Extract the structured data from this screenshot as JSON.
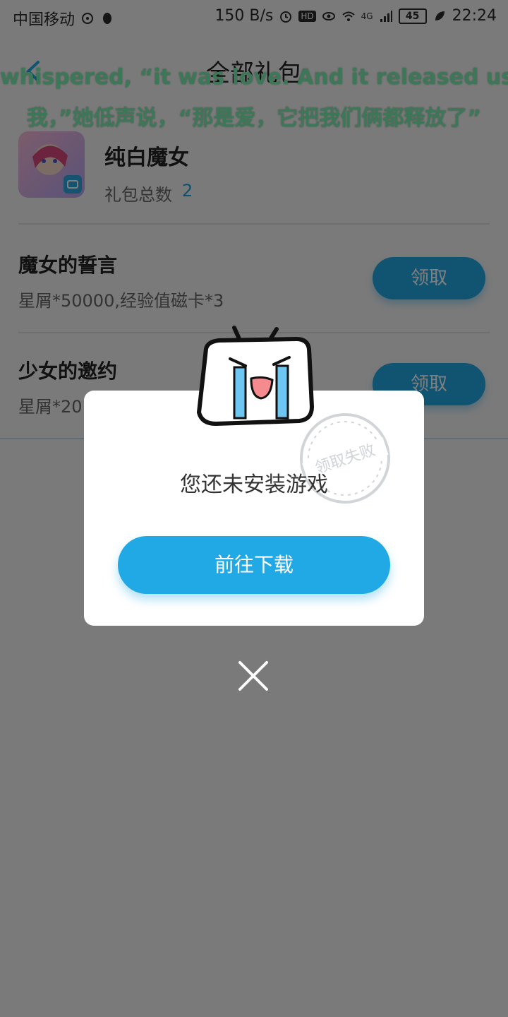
{
  "status_bar": {
    "carrier": "中国移动",
    "network_speed": "150 B/s",
    "network_type": "4G",
    "battery": "45",
    "time": "22:24",
    "hd_badge": "HD"
  },
  "header": {
    "title": "全部礼包"
  },
  "subtitle": {
    "line1": "whispered, “it was love. And it released us both.",
    "line2": "我，”她低声说，“那是爱，它把我们俩都释放了”"
  },
  "game": {
    "name": "纯白魔女",
    "gift_total_label": "礼包总数",
    "gift_total_count": "2"
  },
  "gifts": [
    {
      "name": "魔女的誓言",
      "desc": "星屑*50000,经验值磁卡*3",
      "button": "领取"
    },
    {
      "name": "少女的邀约",
      "desc": "星屑*20",
      "button": "领取"
    }
  ],
  "dialog": {
    "message": "您还未安装游戏",
    "primary_button": "前往下载",
    "stamp_text": "领取失败"
  },
  "colors": {
    "accent": "#21a9e5",
    "subtitle": "#78f1b0"
  }
}
